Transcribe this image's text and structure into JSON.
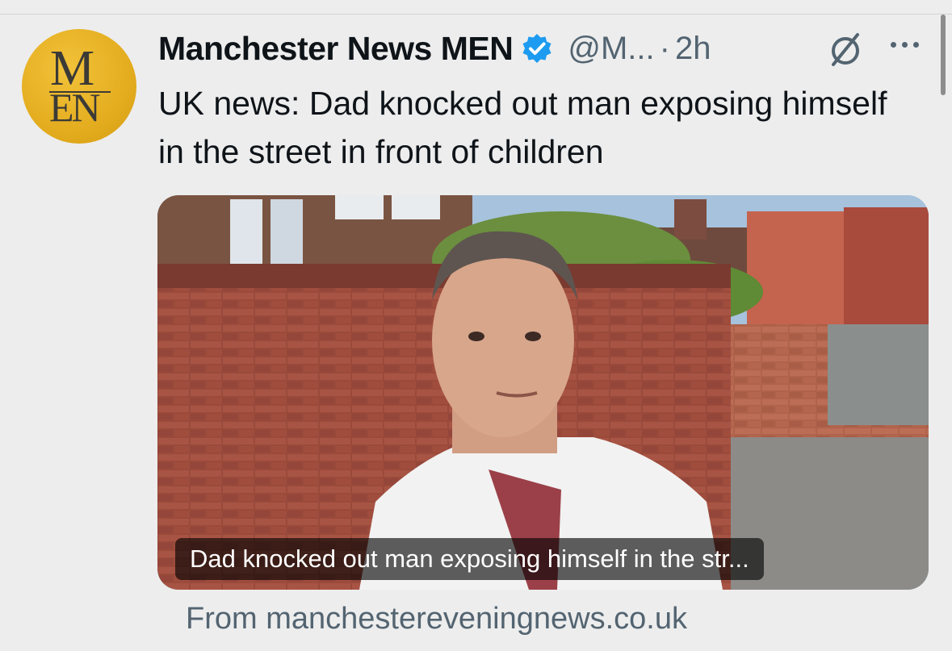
{
  "tweet": {
    "author_name": "Manchester News MEN",
    "handle": "@M...",
    "separator": "·",
    "time": "2h",
    "text": "UK news: Dad knocked out man exposing himself in the street in front of children",
    "avatar": {
      "letters_top": "M",
      "letters_bottom": "EN",
      "background": "#e4ad1f"
    }
  },
  "card": {
    "headline": "Dad knocked out man exposing himself in the str...",
    "source": "From manchestereveningnews.co.uk"
  },
  "icons": [
    "verified-badge-icon",
    "grok-icon",
    "more-options-icon"
  ],
  "colors": {
    "verified": "#1d9bf0",
    "secondary_text": "#536471",
    "background": "#ededed"
  }
}
